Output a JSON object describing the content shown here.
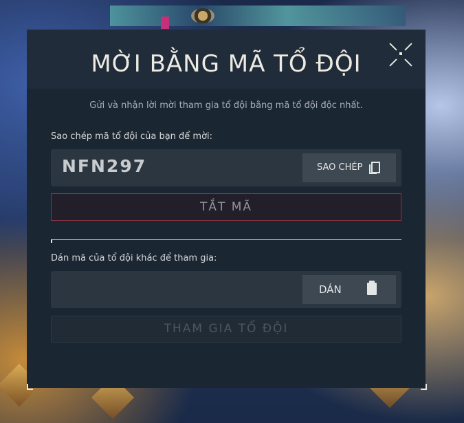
{
  "modal": {
    "title": "MỜI BẰNG MÃ TỔ ĐỘI",
    "subtitle": "Gửi và nhận lời mời tham gia tổ đội bằng mã tổ đội độc nhất."
  },
  "copy_section": {
    "label": "Sao chép mã tổ đội của bạn để mời:",
    "code": "NFN297",
    "copy_label": "SAO CHÉP",
    "disable_label": "TẮT MÃ"
  },
  "paste_section": {
    "label": "Dán mã của tổ đội khác để tham gia:",
    "input_value": "",
    "paste_label": "DÁN",
    "join_label": "THAM GIA TỔ ĐỘI"
  },
  "colors": {
    "modal_bg": "#1b2633",
    "field_bg": "#2c3641",
    "disable_border": "#8c3440",
    "title_text": "#eceae2"
  },
  "icons": [
    "close-icon",
    "copy-icon",
    "clipboard-icon"
  ]
}
